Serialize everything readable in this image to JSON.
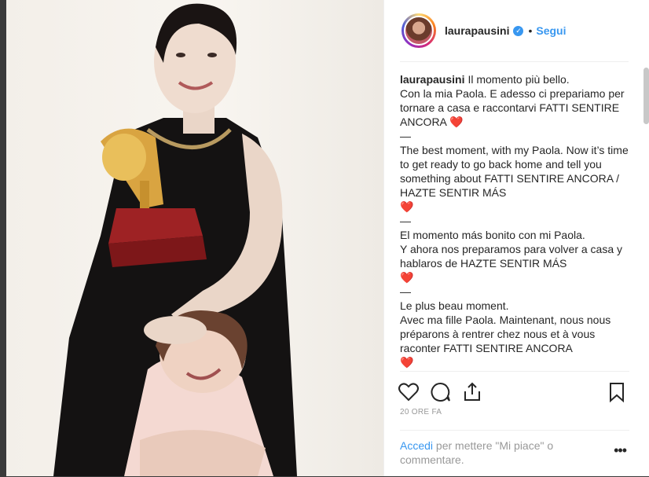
{
  "post": {
    "username": "laurapausini",
    "verified_glyph": "✓",
    "separator": "•",
    "follow_label": "Segui",
    "caption_lines": [
      "Il momento più bello.\nCon la mia Paola. E adesso ci prepariamo per tornare a casa e raccontarvi FATTI SENTIRE ANCORA ❤️",
      "—\nThe best moment, with my Paola. Now it’s time to get ready to go back home and tell you something about FATTI SENTIRE ANCORA / HAZTE SENTIR MÁS\n❤️",
      "—\nEl momento más bonito con mi Paola.\nY ahora nos preparamos para volver a casa y hablaros de HAZTE SENTIR MÁS\n❤️",
      "—\nLe plus beau moment.\nAvec ma fille Paola. Maintenant, nous nous préparons à rentrer chez nous et à vous raconter FATTI SENTIRE ANCORA\n❤️"
    ],
    "timestamp": "20 ORE FA",
    "login_link": "Accedi",
    "login_rest": " per mettere \"Mi piace\" o commentare.",
    "more_glyph": "•••"
  },
  "icons": {
    "like": "heart-icon",
    "comment": "comment-bubble-icon",
    "share": "share-icon",
    "save": "bookmark-icon"
  },
  "colors": {
    "link_blue": "#3897f0",
    "text": "#262626",
    "muted": "#999999",
    "divider": "#efefef"
  }
}
